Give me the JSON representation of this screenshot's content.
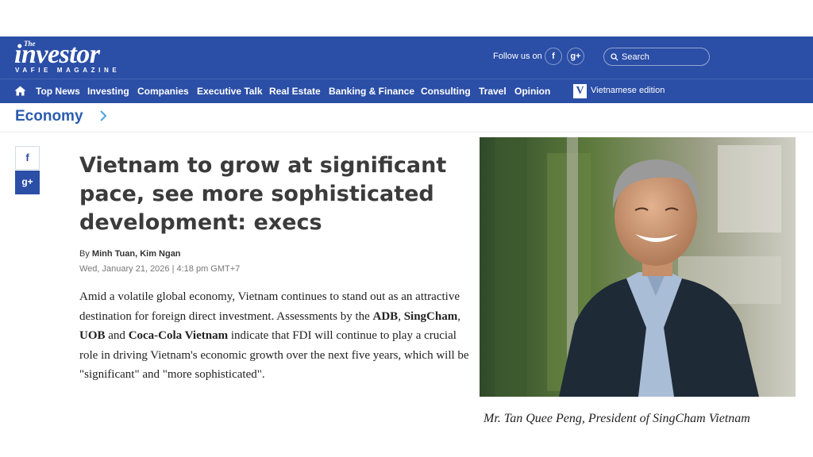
{
  "header": {
    "logo_the": "The",
    "logo_word": "investor",
    "logo_tagline": "VAFIE MAGAZINE",
    "follow_label": "Follow us on",
    "social": [
      {
        "icon": "facebook-icon",
        "glyph": "f"
      },
      {
        "icon": "google-plus-icon",
        "glyph": "g+"
      }
    ],
    "search_label": "Search"
  },
  "nav": {
    "items": [
      "Top News",
      "Investing",
      "Companies",
      "Executive Talk",
      "Real Estate",
      "Banking & Finance",
      "Consulting",
      "Travel",
      "Opinion"
    ],
    "edition_badge": "V",
    "edition_label": "Vietnamese edition"
  },
  "section": {
    "title": "Economy"
  },
  "share": {
    "facebook": "f",
    "googleplus": "g+"
  },
  "article": {
    "headline": "Vietnam to grow at significant pace, see more sophisticated development: execs",
    "byline_prefix": "By",
    "authors": "Minh Tuan, Kim Ngan",
    "date": "Wed, January 21, 2026 | 4:18 pm GMT+7",
    "lead_parts": [
      {
        "t": "Amid a volatile global economy, Vietnam continues to stand out as an attractive destination for foreign direct investment. Assessments by the ",
        "b": false
      },
      {
        "t": "ADB",
        "b": true
      },
      {
        "t": ", ",
        "b": false
      },
      {
        "t": "SingCham",
        "b": true
      },
      {
        "t": ", ",
        "b": false
      },
      {
        "t": "UOB",
        "b": true
      },
      {
        "t": " and ",
        "b": false
      },
      {
        "t": "Coca-Cola Vietnam",
        "b": true
      },
      {
        "t": " indicate that FDI will continue to play a crucial role in driving Vietnam's economic growth over the next five years, which will be \"significant\" and \"more sophisticated\".",
        "b": false
      }
    ],
    "caption": "Mr. Tan Quee Peng, President of SingCham Vietnam"
  },
  "colors": {
    "brand_blue": "#2b4ea6",
    "section_blue": "#2b5bb0"
  }
}
